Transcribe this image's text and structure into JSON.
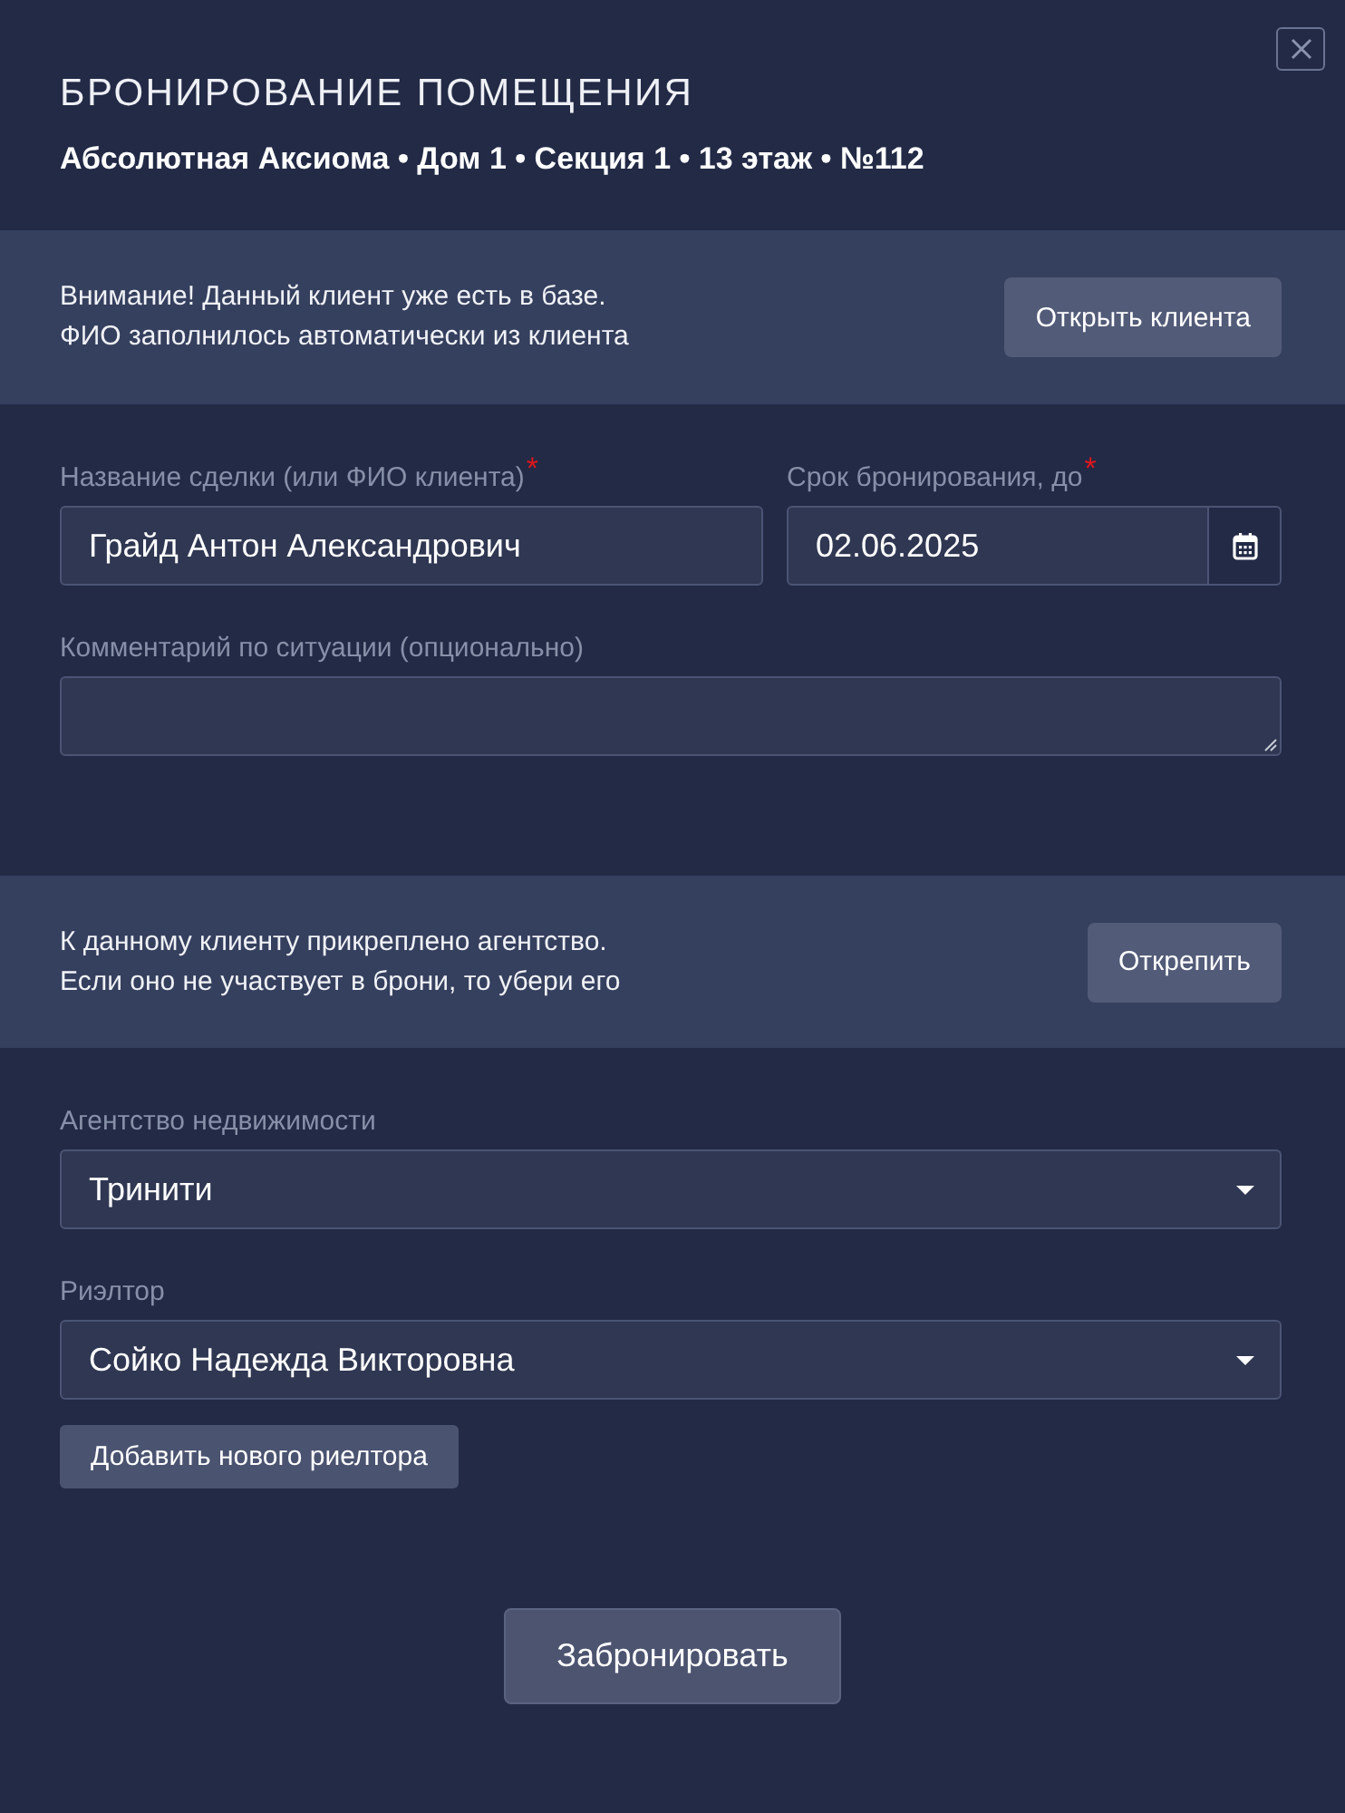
{
  "dialog": {
    "title": "БРОНИРОВАНИЕ ПОМЕЩЕНИЯ",
    "subtitle": "Абсолютная Аксиома • Дом 1 • Секция 1 • 13 этаж • №112"
  },
  "client_notice": {
    "lines": [
      "Внимание! Данный клиент уже есть в базе.",
      "ФИО заполнилось автоматически из клиента"
    ],
    "button": "Открыть клиента"
  },
  "deal_name": {
    "label": "Название сделки (или ФИО клиента)",
    "required_mark": "*",
    "value": "Грайд Антон Александрович"
  },
  "reserve_until": {
    "label": "Срок бронирования, до",
    "required_mark": "*",
    "value": "02.06.2025"
  },
  "comment": {
    "label": "Комментарий по ситуации (опционально)"
  },
  "agency_notice": {
    "lines": [
      "К данному клиенту прикреплено агентство.",
      "Если оно не участвует в брони, то убери его"
    ],
    "button": "Открепить"
  },
  "agency": {
    "label": "Агентство недвижимости",
    "value": "Тринити"
  },
  "realtor": {
    "label": "Риэлтор",
    "value": "Сойко Надежда Викторовна"
  },
  "add_realtor_button": "Добавить нового риелтора",
  "submit_button": "Забронировать"
}
